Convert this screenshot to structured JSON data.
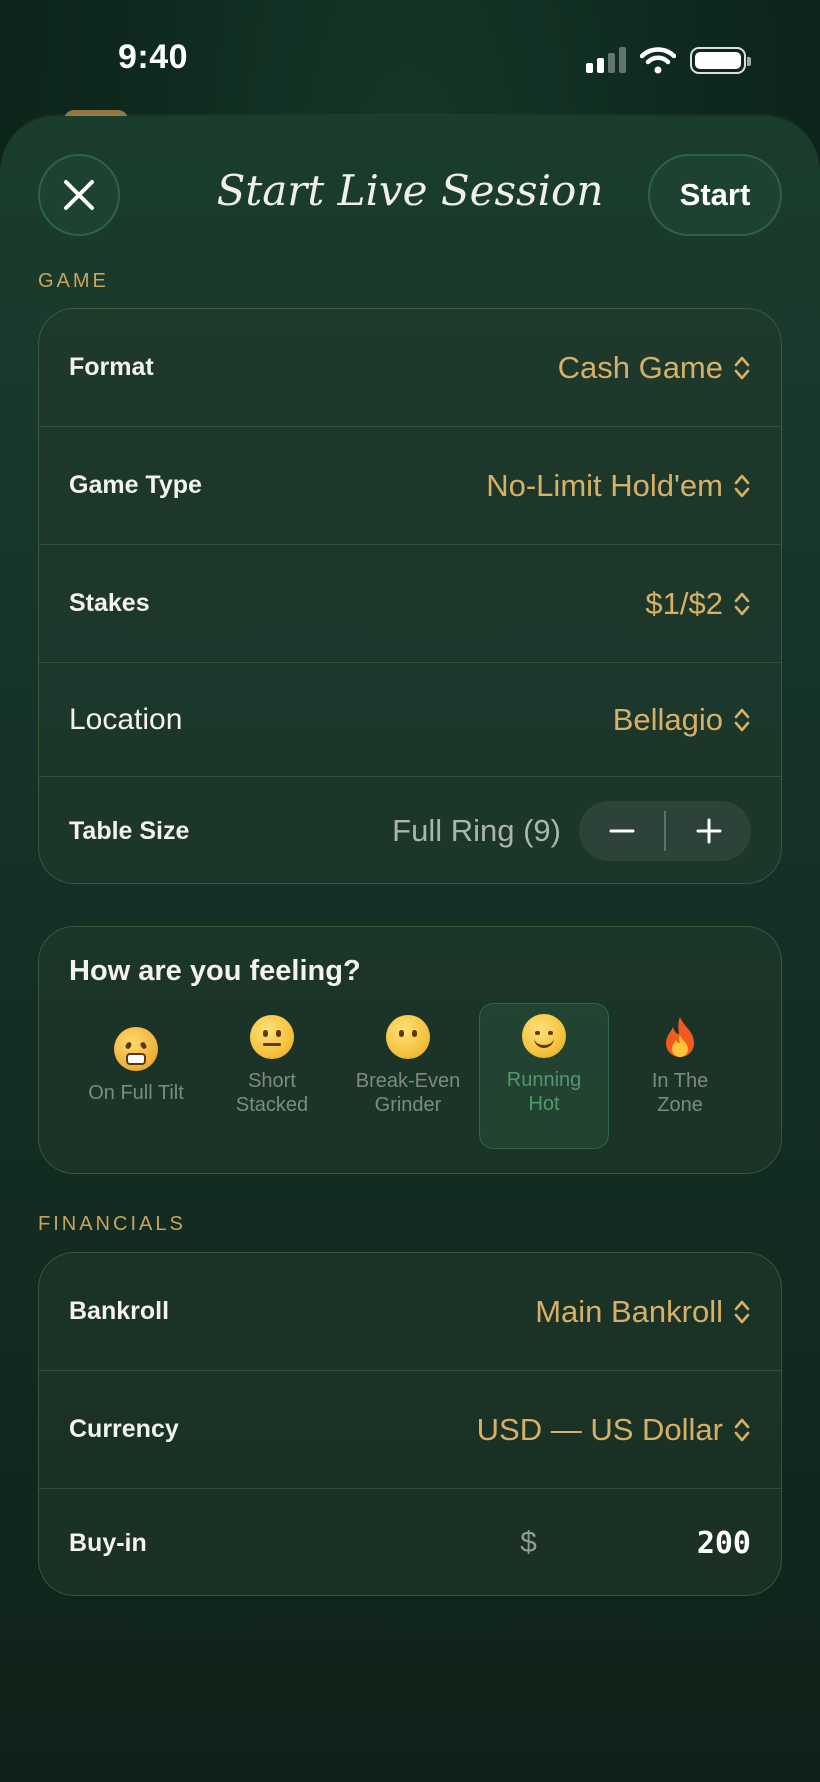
{
  "status_bar": {
    "time": "9:40"
  },
  "sheet": {
    "title": "Start Live Session",
    "start_label": "Start"
  },
  "game": {
    "section_label": "GAME",
    "rows": {
      "format": {
        "label": "Format",
        "value": "Cash Game"
      },
      "game_type": {
        "label": "Game Type",
        "value": "No-Limit Hold'em"
      },
      "stakes": {
        "label": "Stakes",
        "value": "$1/$2"
      },
      "location": {
        "label": "Location",
        "value": "Bellagio"
      },
      "table_size": {
        "label": "Table Size",
        "value": "Full Ring (9)"
      }
    }
  },
  "mood": {
    "title": "How are you feeling?",
    "options": [
      {
        "label": "On Full Tilt",
        "icon": "angry-face-icon",
        "selected": false
      },
      {
        "label": "Short\nStacked",
        "icon": "neutral-face-icon",
        "selected": false
      },
      {
        "label": "Break-Even\nGrinder",
        "icon": "flat-face-icon",
        "selected": false
      },
      {
        "label": "Running\nHot",
        "icon": "smiling-face-icon",
        "selected": true
      },
      {
        "label": "In The\nZone",
        "icon": "fire-icon",
        "selected": false
      }
    ]
  },
  "financials": {
    "section_label": "FINANCIALS",
    "rows": {
      "bankroll": {
        "label": "Bankroll",
        "value": "Main Bankroll"
      },
      "currency": {
        "label": "Currency",
        "value": "USD — US Dollar"
      },
      "buyin": {
        "label": "Buy-in",
        "currency_symbol": "$",
        "value": "200"
      }
    }
  },
  "colors": {
    "accent_gold": "#d6b067",
    "selected_green": "#4f9a6b"
  }
}
